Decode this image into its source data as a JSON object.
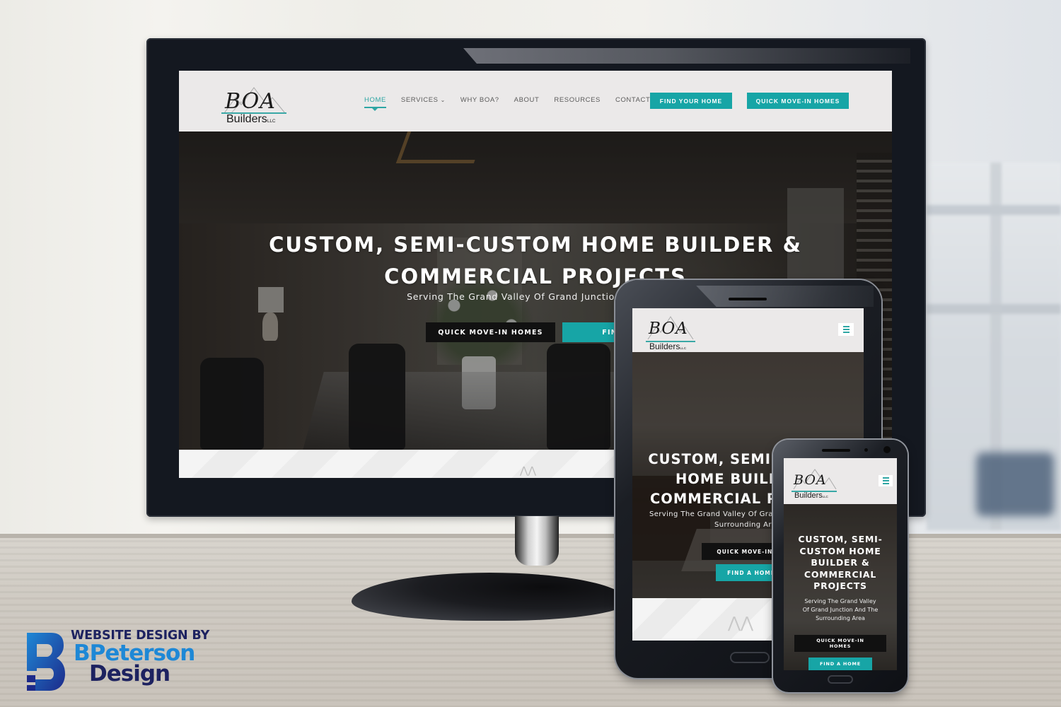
{
  "brand": {
    "logo_main": "BOA",
    "logo_sub": "Builders",
    "logo_suffix": "LLC",
    "accent_color": "#17a5a6",
    "dark_button_color": "#111111"
  },
  "desktop": {
    "nav": {
      "items": [
        {
          "label": "HOME",
          "active": true
        },
        {
          "label": "SERVICES",
          "has_dropdown": true
        },
        {
          "label": "WHY BOA?"
        },
        {
          "label": "ABOUT"
        },
        {
          "label": "RESOURCES"
        },
        {
          "label": "CONTACT"
        }
      ],
      "dropdown_icon": "chevron-down-icon",
      "find_your_home_label": "FIND YOUR HOME",
      "quick_move_in_label": "QUICK MOVE-IN HOMES"
    },
    "hero": {
      "title_line1": "CUSTOM, SEMI-CUSTOM HOME BUILDER &",
      "title_line2": "COMMERCIAL PROJECTS",
      "subtitle": "Serving The Grand Valley Of Grand Junction And The",
      "quick_move_in_label": "QUICK MOVE-IN HOMES",
      "find_home_label": "FIND A H"
    }
  },
  "tablet": {
    "menu_icon": "hamburger-menu-icon",
    "hero": {
      "title_line1": "CUSTOM, SEMI-CUSTOM",
      "title_line2": "HOME BUILDER &",
      "title_line3": "COMMERCIAL P",
      "subtitle_line1": "Serving The Grand Valley Of Gran",
      "subtitle_line2": "Surrounding Ar",
      "quick_move_in_label": "QUICK MOVE-IN HO",
      "find_home_label": "FIND A HOME"
    }
  },
  "phone": {
    "menu_icon": "hamburger-menu-icon",
    "hero": {
      "title_line1": "CUSTOM, SEMI-",
      "title_line2": "CUSTOM HOME",
      "title_line3": "BUILDER &",
      "title_line4": "COMMERCIAL",
      "title_line5": "PROJECTS",
      "subtitle_line1": "Serving The Grand Valley",
      "subtitle_line2": "Of Grand Junction And The",
      "subtitle_line3": "Surrounding Area",
      "quick_move_in_line1": "QUICK MOVE-IN",
      "quick_move_in_line2": "HOMES",
      "find_home_label": "FIND A HOME"
    }
  },
  "credit": {
    "tagline": "WEBSITE DESIGN BY",
    "name_line1": "BPeterson",
    "name_line2": "Design",
    "primary_color": "#1d2260",
    "secondary_color": "#1e88d6"
  }
}
